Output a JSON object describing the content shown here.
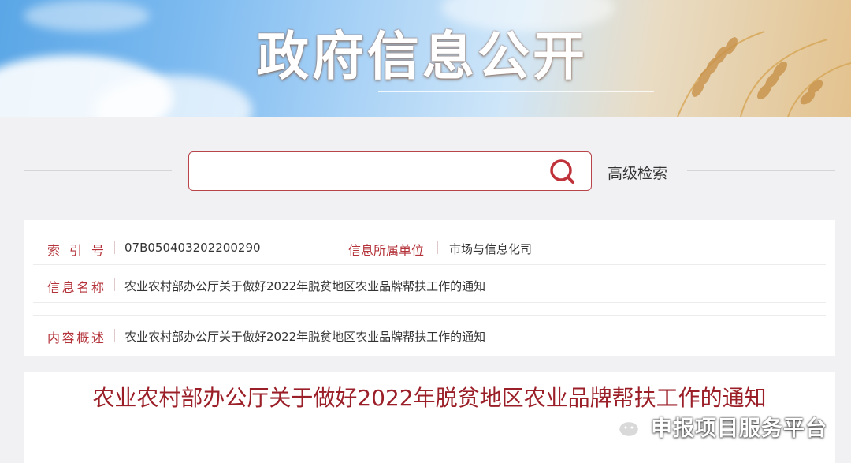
{
  "banner": {
    "title": "政府信息公开"
  },
  "search": {
    "placeholder": "",
    "advanced_label": "高级检索"
  },
  "info": {
    "index_label": "索 引 号",
    "index_value": "07B050403202200290",
    "unit_label": "信息所属单位",
    "unit_value": "市场与信息化司",
    "name_label": "信息名称",
    "name_value": "农业农村部办公厅关于做好2022年脱贫地区农业品牌帮扶工作的通知",
    "summary_label": "内容概述",
    "summary_value": "农业农村部办公厅关于做好2022年脱贫地区农业品牌帮扶工作的通知"
  },
  "article": {
    "title": "农业农村部办公厅关于做好2022年脱贫地区农业品牌帮扶工作的通知"
  },
  "watermark": {
    "text": "申报项目服务平台",
    "icon": "wechat-icon"
  },
  "colors": {
    "accent": "#b4333a",
    "title": "#9b1f28",
    "search_border": "#b8454a"
  }
}
